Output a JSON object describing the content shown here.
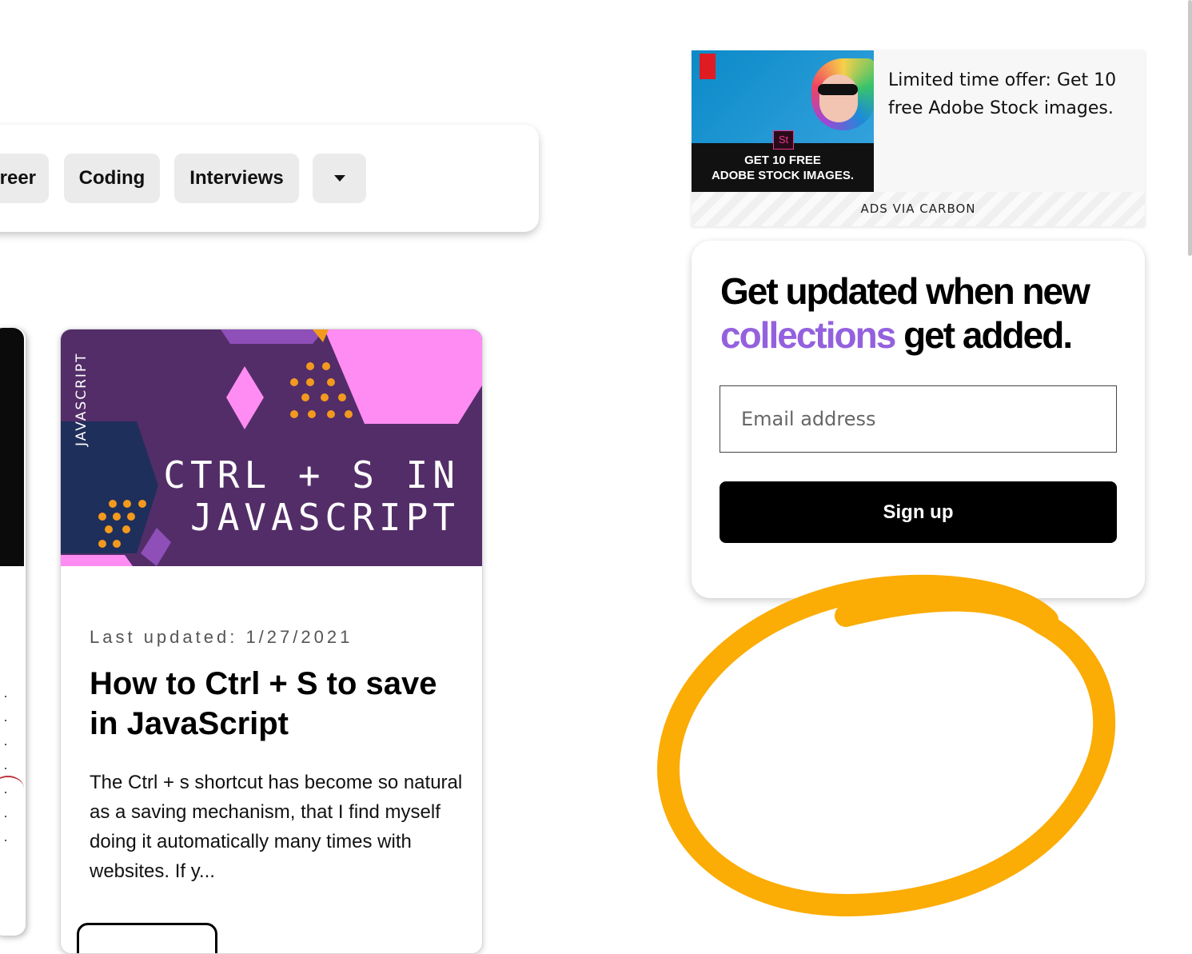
{
  "categories": {
    "items": [
      {
        "label": "reer"
      },
      {
        "label": "Coding"
      },
      {
        "label": "Interviews"
      }
    ],
    "dropdown_icon": "caret-down-icon"
  },
  "article": {
    "thumbnail": {
      "tag": "JAVASCRIPT",
      "title_line1": "CTRL + S IN",
      "title_line2": "JAVASCRIPT"
    },
    "updated": "Last updated: 1/27/2021",
    "title": "How to Ctrl + S to save in JavaScript",
    "excerpt": "The Ctrl + s shortcut has become so natural as a saving mechanism, that I find myself doing it automatically many times with websites. If y..."
  },
  "ad": {
    "image_text_line1": "GET 10 FREE",
    "image_text_line2": "ADOBE STOCK IMAGES.",
    "image_badge": "St",
    "text": "Limited time offer: Get 10 free Adobe Stock images.",
    "footer": "ADS VIA CARBON"
  },
  "newsletter": {
    "title_part1": "Get updated when new",
    "title_accent": "collections",
    "title_part2": "get added.",
    "email_placeholder": "Email address",
    "signup_label": "Sign up"
  },
  "colors": {
    "accent": "#9461de",
    "annotation": "#fbac05",
    "thumbnail_bg": "#532d68"
  }
}
